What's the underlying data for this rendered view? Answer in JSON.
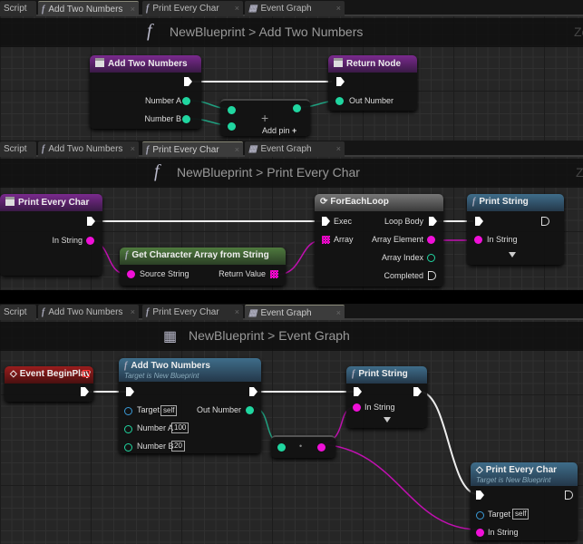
{
  "tabs": [
    {
      "label": "Script"
    },
    {
      "label": "Add Two Numbers",
      "icon": "function-icon"
    },
    {
      "label": "Print Every Char",
      "icon": "function-icon"
    },
    {
      "label": "Event Graph",
      "icon": "event-graph-icon"
    }
  ],
  "colors": {
    "exec": "#ffffff",
    "integer": "#20d6a0",
    "string": "#f010d8",
    "object": "#3a9ad8",
    "function_header": "#7a2a8e",
    "call_header": "#3f6d8a",
    "pure_header": "#4f7a3e",
    "event_header": "#9a1d1d"
  },
  "panel1": {
    "active_tab": "Add Two Numbers",
    "breadcrumb": {
      "root": "NewBlueprint",
      "sep": ">",
      "current": "Add Two Numbers"
    },
    "entry": {
      "title": "Add Two Numbers",
      "pins": [
        "Number A",
        "Number B"
      ]
    },
    "add": {
      "symbol": "+",
      "add_pin": "Add pin",
      "add_pin_icon": "+"
    },
    "ret": {
      "title": "Return Node",
      "pins": [
        "Out Number"
      ]
    },
    "zoom_hint": "Zo"
  },
  "panel2": {
    "active_tab": "Print Every Char",
    "breadcrumb": {
      "root": "NewBlueprint",
      "sep": ">",
      "current": "Print Every Char"
    },
    "entry": {
      "title": "Print Every Char",
      "pins": [
        "In String"
      ]
    },
    "getarr": {
      "title": "Get Character Array from String",
      "in": "Source String",
      "out": "Return Value"
    },
    "loop": {
      "title": "ForEachLoop",
      "in": [
        "Exec",
        "Array"
      ],
      "out": [
        "Loop Body",
        "Array Element",
        "Array Index",
        "Completed"
      ]
    },
    "print": {
      "title": "Print String",
      "pins": [
        "In String"
      ]
    },
    "zoom_hint": "Z"
  },
  "panel3": {
    "active_tab": "Event Graph",
    "breadcrumb": {
      "root": "NewBlueprint",
      "sep": ">",
      "current": "Event Graph"
    },
    "begin": {
      "title": "Event BeginPlay"
    },
    "add": {
      "title": "Add Two Numbers",
      "subtitle": "Target is New Blueprint",
      "target": "Target",
      "target_val": "self",
      "a": "Number A",
      "a_val": "100",
      "b": "Number B",
      "b_val": "20",
      "out": "Out Number"
    },
    "print": {
      "title": "Print String",
      "pins": [
        "In String"
      ]
    },
    "conv": {
      "symbol": "•"
    },
    "pec": {
      "title": "Print Every Char",
      "subtitle": "Target is New Blueprint",
      "target": "Target",
      "target_val": "self",
      "in": "In String"
    }
  }
}
